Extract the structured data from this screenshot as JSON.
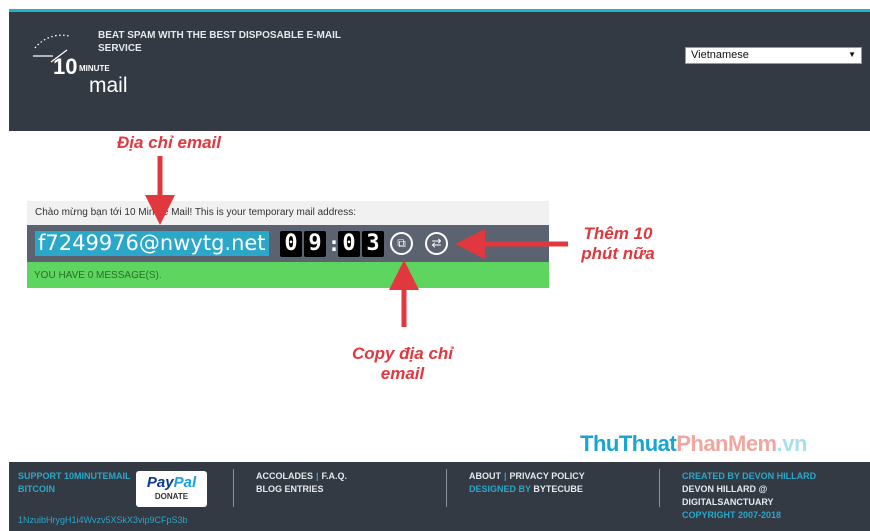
{
  "header": {
    "logo_main": "10",
    "logo_minute": "MINUTE",
    "logo_mail": "mail",
    "tagline": "BEAT SPAM WITH THE BEST DISPOSABLE E-MAIL SERVICE",
    "language": "Vietnamese"
  },
  "main": {
    "intro": "Chào mừng bạn tới 10 Minute Mail! This is your temporary mail address:",
    "email": "f7249976@nwytg.net",
    "timer": {
      "d1": "0",
      "d2": "9",
      "d3": "0",
      "d4": "3"
    },
    "copy_icon": "⧉",
    "refresh_icon": "⇄",
    "messages_status": "YOU HAVE 0 MESSAGE(S)."
  },
  "annotations": {
    "email_label": "Địa chỉ email",
    "add_time_label": "Thêm 10 phút nữa",
    "copy_label": "Copy địa chỉ email",
    "color": "#e0383e"
  },
  "watermark": {
    "part1": "ThuThuat",
    "part2": "PhanMem",
    "part3": ".vn"
  },
  "footer": {
    "support": "SUPPORT 10MINUTEMAIL",
    "bitcoin": "BITCOIN",
    "paypal_pay": "Pay",
    "paypal_pal": "Pal",
    "paypal_donate": "DONATE",
    "btc_address": "1NzuibHrygH1i4Wvzv5XSkX3vip9CFpS3b",
    "accolades": "ACCOLADES",
    "faq": "F.A.Q.",
    "blog": "BLOG ENTRIES",
    "about": "ABOUT",
    "privacy": "PRIVACY POLICY",
    "designed_by": "DESIGNED BY",
    "bytecube": "BYTECUBE",
    "created_by": "CREATED BY DEVON HILLARD",
    "devon": "DEVON HILLARD @",
    "digital": "DIGITALSANCTUARY",
    "copyright": "COPYRIGHT 2007-2018",
    "pipe": "|"
  }
}
